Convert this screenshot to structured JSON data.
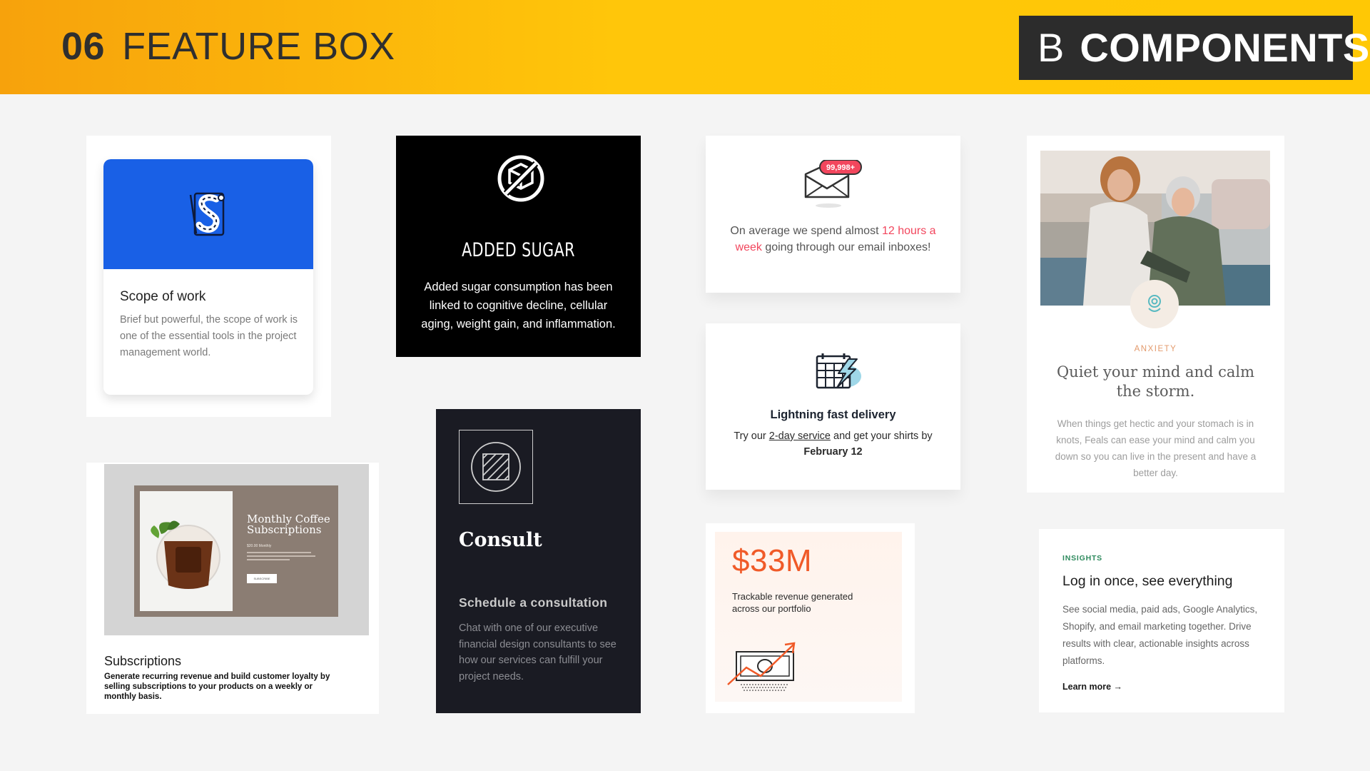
{
  "header": {
    "section_number": "06",
    "section_title": "FEATURE BOX",
    "badge_letter": "B",
    "badge_title": "COMPONENTS"
  },
  "cards": {
    "scope": {
      "title": "Scope of work",
      "body": "Brief but powerful, the scope of work is one of the essential tools in the project management world."
    },
    "sugar": {
      "title": "ADDED SUGAR",
      "body": "Added sugar consumption has been linked to cognitive decline, cellular aging, weight gain, and inflammation."
    },
    "email": {
      "badge": "99,998+",
      "text_before": "On average we spend almost ",
      "highlight": "12 hours a week",
      "text_after": " going through our email inboxes!"
    },
    "anxiety": {
      "kicker": "ANXIETY",
      "title": "Quiet your mind and calm the storm.",
      "body": "When things get hectic and your stomach is in knots, Feals can ease your mind and calm you down so you can live in the present and have a better day."
    },
    "delivery": {
      "title": "Lightning fast delivery",
      "text_before": "Try our ",
      "link": "2-day service",
      "text_middle": " and get your shirts by ",
      "date": "February 12"
    },
    "subscriptions": {
      "mock_title": "Monthly Coffee Subscriptions",
      "mock_price": "$20.00 Monthly",
      "mock_button": "SUBSCRIBE",
      "title": "Subscriptions",
      "body": "Generate recurring revenue and build customer loyalty by selling subscriptions to your products on a weekly or monthly basis."
    },
    "consult": {
      "title": "Consult",
      "subtitle": "Schedule a consultation",
      "body": "Chat with one of our executive financial design consultants to see how our services can fulfill your project needs."
    },
    "revenue": {
      "amount": "$33M",
      "body": "Trackable revenue generated across our portfolio"
    },
    "insights": {
      "kicker": "INSIGHTS",
      "title": "Log in once, see everything",
      "body": "See social media, paid ads, Google Analytics, Shopify, and email marketing together. Drive results with clear, actionable insights across platforms.",
      "link": "Learn more →"
    }
  },
  "colors": {
    "header_yellow": "#ffc60a",
    "header_orange": "#f7a20c",
    "scope_blue": "#1960e6",
    "email_highlight": "#f2465d",
    "revenue_orange": "#f05a28",
    "insights_green": "#2d8a5d"
  },
  "icons": {
    "scope": "scope-document-icon",
    "sugar": "no-sugar-icon",
    "email": "envelope-icon",
    "delivery": "calendar-lightning-icon",
    "anxiety": "feals-logo-icon",
    "consult": "hatched-circle-icon",
    "revenue": "money-chart-icon"
  }
}
